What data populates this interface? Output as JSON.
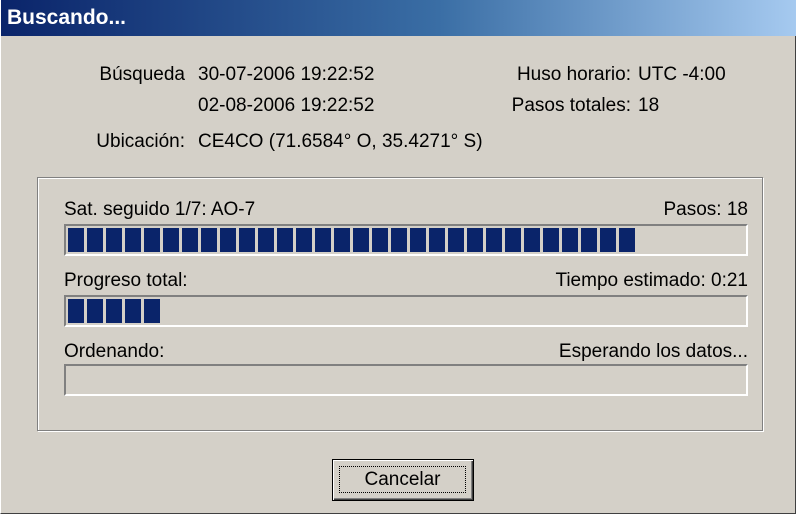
{
  "window": {
    "title": "Buscando..."
  },
  "info": {
    "search_label": "Búsqueda",
    "search_start": "30-07-2006 19:22:52",
    "search_end": "02-08-2006 19:22:52",
    "location_label": "Ubicación:",
    "location_value": "CE4CO (71.6584° O, 35.4271° S)",
    "timezone_label": "Huso horario:",
    "timezone_value": "UTC -4:00",
    "total_steps_label": "Pasos totales:",
    "total_steps_value": "18"
  },
  "progress": {
    "satellite_label": "Sat. seguido 1/7: AO-7",
    "steps_text": "Pasos: 18",
    "satellite_fraction": 0.85,
    "total_label": "Progreso total:",
    "estimated_time": "Tiempo estimado: 0:21",
    "total_fraction": 0.145,
    "sorting_label": "Ordenando:",
    "sorting_status": "Esperando los datos...",
    "sorting_fraction": 0
  },
  "buttons": {
    "cancel_label": "Cancelar"
  }
}
